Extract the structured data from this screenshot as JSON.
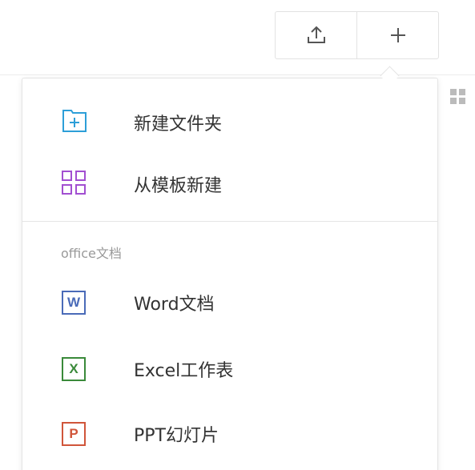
{
  "toolbar": {
    "upload_icon": "upload-icon",
    "add_icon": "plus-icon"
  },
  "view_toggle": {
    "icon": "grid-view-icon"
  },
  "menu": {
    "items_top": [
      {
        "label": "新建文件夹",
        "icon": "folder-add-icon",
        "color": "#2d9fd8"
      },
      {
        "label": "从模板新建",
        "icon": "template-grid-icon",
        "color": "#a24fd1"
      }
    ],
    "section_title": "office文档",
    "items_office": [
      {
        "label": "Word文档",
        "icon": "word-icon",
        "glyph": "W",
        "color": "#4a6bb8"
      },
      {
        "label": "Excel工作表",
        "icon": "excel-icon",
        "glyph": "X",
        "color": "#3a8a3a"
      },
      {
        "label": "PPT幻灯片",
        "icon": "ppt-icon",
        "glyph": "P",
        "color": "#d0553a"
      }
    ]
  }
}
